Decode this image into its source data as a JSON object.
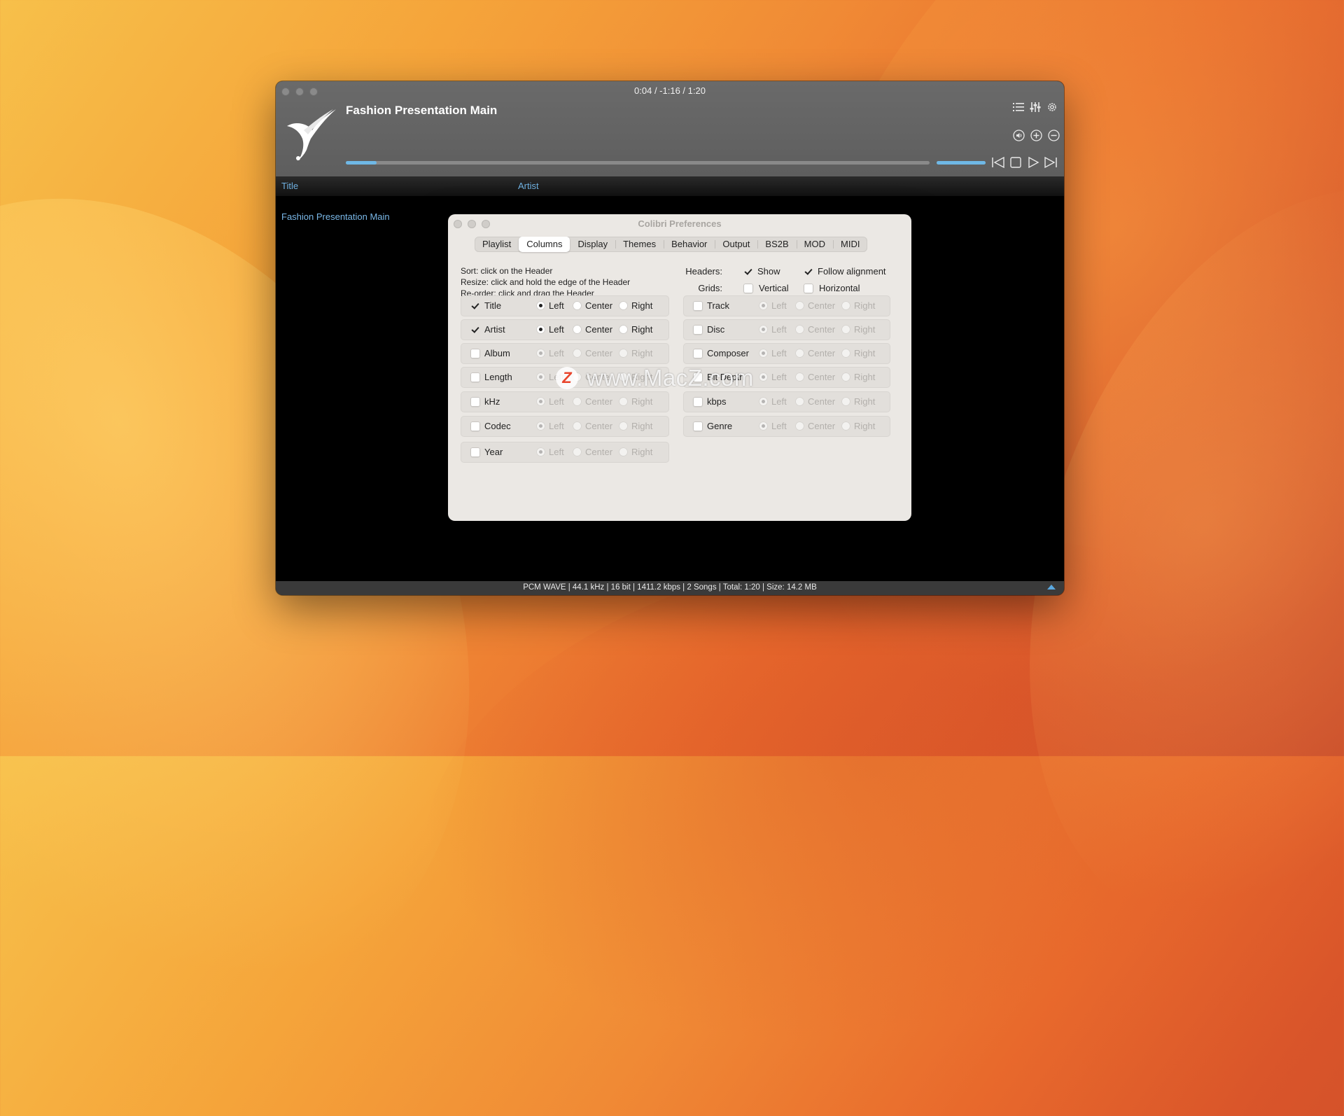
{
  "player": {
    "time": "0:04 / -1:16 / 1:20",
    "track_title": "Fashion Presentation Main",
    "progress": 0.053,
    "volume": 1.0,
    "status": "PCM WAVE | 44.1 kHz | 16 bit | 1411.2 kbps | 2 Songs | Total: 1:20 | Size: 14.2 MB",
    "accent_color": "#6fb8e6"
  },
  "columns": {
    "title": "Title",
    "artist": "Artist"
  },
  "playlist": {
    "rows": [
      {
        "title": "Fashion Presentation Main"
      }
    ]
  },
  "prefs": {
    "window_title": "Colibri Preferences",
    "tabs": [
      "Playlist",
      "Columns",
      "Display",
      "Themes",
      "Behavior",
      "Output",
      "BS2B",
      "MOD",
      "MIDI"
    ],
    "active_tab": "Columns",
    "instructions": [
      "Sort: click on the Header",
      "Resize: click and hold the edge of the Header",
      "Re-order: click and drag the Header"
    ],
    "headers_label": "Headers:",
    "grids_label": "Grids:",
    "show_label": "Show",
    "follow_label": "Follow alignment",
    "vertical_label": "Vertical",
    "horizontal_label": "Horizontal",
    "align_left": "Left",
    "align_center": "Center",
    "align_right": "Right",
    "left_items": [
      "Title",
      "Artist",
      "Album",
      "Length",
      "kHz",
      "Codec",
      "Year"
    ],
    "right_items": [
      "Track",
      "Disc",
      "Composer",
      "Bit Depth",
      "kbps",
      "Genre"
    ]
  },
  "watermark": {
    "logo_letter": "Z",
    "text": "www.MacZ.com"
  }
}
